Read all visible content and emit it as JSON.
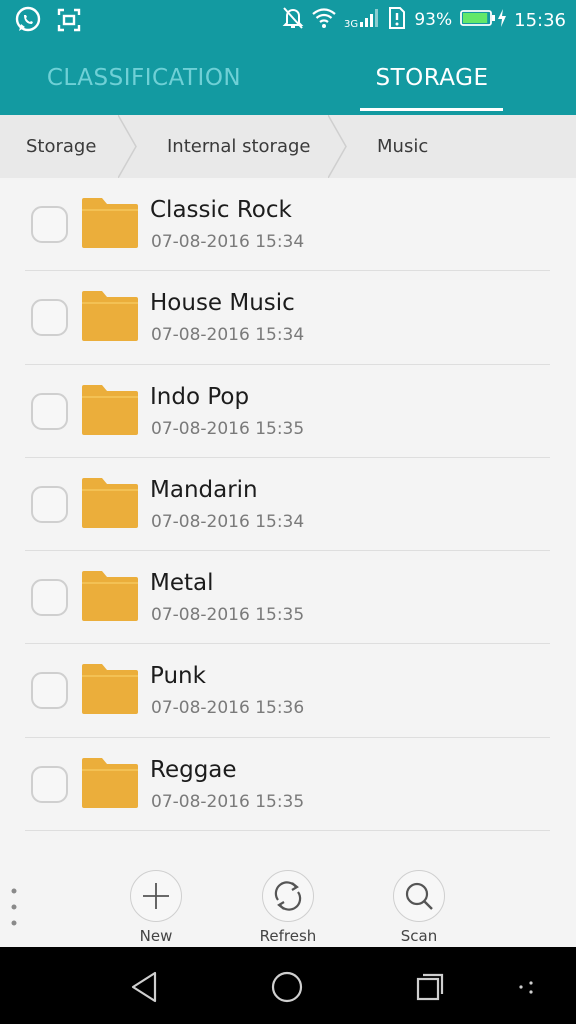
{
  "status_bar": {
    "left_icons": [
      "whatsapp-icon",
      "screenshot-icon"
    ],
    "right_icons": [
      "notifications-off-icon",
      "wifi-icon",
      "signal-3g-icon",
      "sim-alert-icon",
      "battery-icon",
      "charging-icon"
    ],
    "battery_percent": "93%",
    "battery_level": 0.93,
    "time": "15:36"
  },
  "tabs": [
    {
      "label": "CLASSIFICATION",
      "active": false
    },
    {
      "label": "STORAGE",
      "active": true
    }
  ],
  "breadcrumb": [
    "Storage",
    "Internal storage",
    "Music"
  ],
  "files": [
    {
      "name": "Classic Rock",
      "date": "07-08-2016 15:34"
    },
    {
      "name": "House Music",
      "date": "07-08-2016 15:34"
    },
    {
      "name": "Indo Pop",
      "date": "07-08-2016 15:35"
    },
    {
      "name": "Mandarin",
      "date": "07-08-2016 15:34"
    },
    {
      "name": "Metal",
      "date": "07-08-2016 15:35"
    },
    {
      "name": "Punk",
      "date": "07-08-2016 15:36"
    },
    {
      "name": "Reggae",
      "date": "07-08-2016 15:35"
    }
  ],
  "toolbar": {
    "new_label": "New",
    "refresh_label": "Refresh",
    "scan_label": "Scan"
  },
  "colors": {
    "accent": "#139aa1",
    "tab_inactive": "#6fd0d6",
    "folder": "#ebae3b"
  }
}
